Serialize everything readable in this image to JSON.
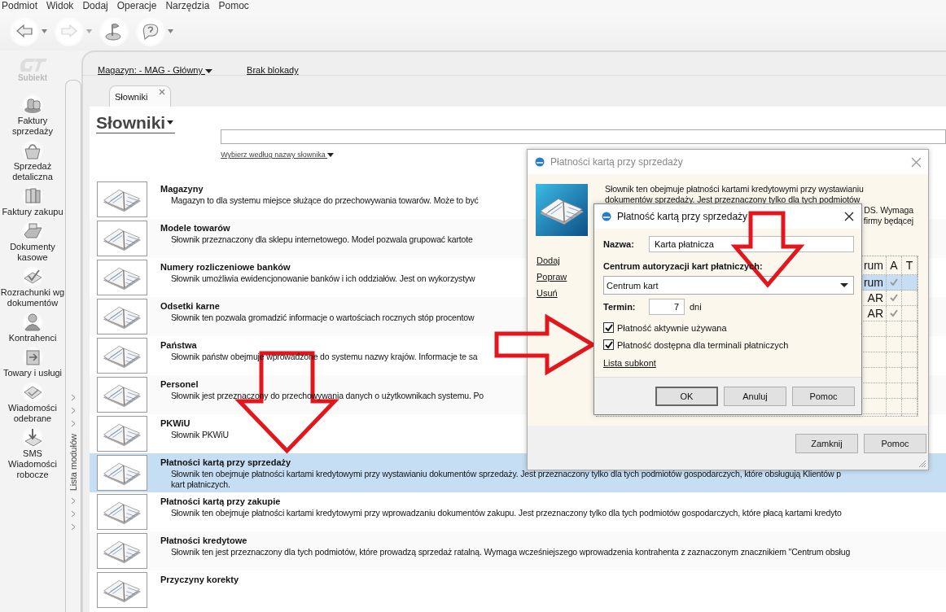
{
  "menu": [
    "Podmiot",
    "Widok",
    "Dodaj",
    "Operacje",
    "Narzędzia",
    "Pomoc"
  ],
  "toolbar": [
    {
      "dropdown": true,
      "disabled": false
    },
    {
      "dropdown": true,
      "disabled": true
    },
    {
      "dropdown": false,
      "disabled": false
    },
    {
      "dropdown": true,
      "disabled": false
    }
  ],
  "app_logo": {
    "label": "Subiekt"
  },
  "modules": [
    {
      "label": "Faktury sprzedaży"
    },
    {
      "label": "Sprzedaż detaliczna"
    },
    {
      "label": "Faktury zakupu"
    },
    {
      "label": "Dokumenty kasowe"
    },
    {
      "label": "Rozrachunki wg dokumentów"
    },
    {
      "label": "Kontrahenci"
    },
    {
      "label": "Towary i usługi"
    },
    {
      "label": "Wiadomości odebrane"
    },
    {
      "label": "SMS Wiadomości robocze"
    }
  ],
  "modules_strip": {
    "label": "Lista modułów"
  },
  "location_bar": {
    "warehouse": "Magazyn: - MAG - Główny",
    "lock": "Brak blokady"
  },
  "tabs": [
    {
      "label": "Słowniki",
      "selected": true
    }
  ],
  "page": {
    "title": "Słowniki",
    "filter_link": "Wybierz według nazwy słownika"
  },
  "dictionaries": [
    {
      "name": "Magazyny",
      "lines": [
        "Magazyn to dla systemu miejsce służące do przechowywania towarów. Może to być"
      ],
      "selected": false
    },
    {
      "name": "Modele towarów",
      "lines": [
        "Słownik przeznaczony dla sklepu internetowego. Model pozwala grupować kartote"
      ],
      "selected": false
    },
    {
      "name": "Numery rozliczeniowe banków",
      "lines": [
        "Słownik umożliwia ewidencjonowanie banków i ich oddziałów. Jest on wykorzystyw"
      ],
      "selected": false
    },
    {
      "name": "Odsetki karne",
      "lines": [
        "Słownik ten pozwala gromadzić informacje o wartościach rocznych stóp procentow"
      ],
      "selected": false
    },
    {
      "name": "Państwa",
      "lines": [
        "Słownik państw obejmuje wprowadzone do systemu nazwy krajów. Informacje te sa"
      ],
      "selected": false
    },
    {
      "name": "Personel",
      "lines": [
        "Słownik jest przeznaczony do przechowywania danych o użytkownikach systemu. Po"
      ],
      "selected": false
    },
    {
      "name": "PKWiU",
      "lines": [
        "Słownik PKWiU"
      ],
      "selected": false
    },
    {
      "name": "Płatności kartą przy sprzedaży",
      "lines": [
        "Słownik ten obejmuje płatności kartami kredytowymi przy wystawianiu dokumentów sprzedaży. Jest przeznaczony tylko dla tych podmiotów gospodarczych, które obsługują Klientów p",
        "kart płatniczych."
      ],
      "selected": true
    },
    {
      "name": "Płatności kartą przy zakupie",
      "lines": [
        "Słownik ten obejmuje płatności kartami kredytowymi przy wprowadzaniu dokumentów zakupu. Jest przeznaczony tylko dla tych podmiotów gospodarczych, które płacą kartami kredyto"
      ],
      "selected": false
    },
    {
      "name": "Płatności kredytowe",
      "lines": [
        "Słownik ten jest przeznaczony dla tych podmiotów, które prowadzą sprzedaż ratalną. Wymaga wcześniejszego wprowadzenia kontrahenta z zaznaczonym znacznikiem \"Centrum obsług"
      ],
      "selected": false
    },
    {
      "name": "Przyczyny korekty",
      "selected": false
    }
  ],
  "dialog": {
    "title": "Płatności kartą przy sprzedaży",
    "description": [
      "Słownik ten obejmuje płatności kartami kredytowymi przy wystawianiu",
      "dokumentów sprzedaży. Jest przeznaczony tylko dla tych podmiotów"
    ],
    "description_tail": [
      "DS. Wymaga",
      "firmy będącej"
    ],
    "links": [
      "Dodaj",
      "Popraw",
      "Usuń"
    ],
    "grid": {
      "columns": [
        "rum",
        "A",
        "T"
      ],
      "rows": [
        {
          "cell": "rum",
          "a": true,
          "selected": true
        },
        {
          "cell": "AR",
          "a": true,
          "selected": false
        },
        {
          "cell": "AR",
          "a": true,
          "selected": false
        }
      ]
    },
    "buttons": [
      "Zamknij",
      "Pomoc"
    ]
  },
  "edit_dialog": {
    "title": "Płatność kartą przy sprzedaży",
    "name_label": "Nazwa:",
    "name_value": "Karta płatnicza",
    "center_label": "Centrum autoryzacji kart płatniczych:",
    "center_value": "Centrum kart",
    "term_label": "Termin:",
    "term_value": "7",
    "term_unit": "dni",
    "checkboxes": [
      {
        "label": "Płatność aktywnie używana",
        "checked": true
      },
      {
        "label": "Płatność dostępna dla terminali płatniczych",
        "checked": true
      }
    ],
    "link": "Lista subkont",
    "buttons": [
      {
        "label": "OK",
        "default": true
      },
      {
        "label": "Anuluj",
        "default": false
      },
      {
        "label": "Pomoc",
        "default": false
      }
    ]
  },
  "annotations": [
    {
      "kind": "arrow-down"
    },
    {
      "kind": "arrow-down"
    },
    {
      "kind": "arrow-right"
    }
  ]
}
